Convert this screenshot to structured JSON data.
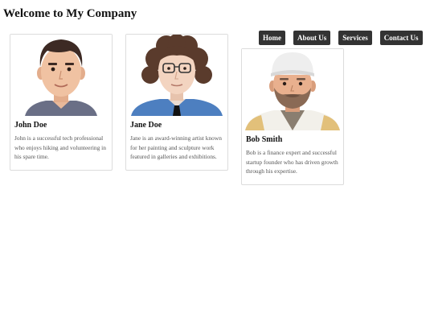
{
  "header": {
    "title": "Welcome to My Company"
  },
  "nav": {
    "items": [
      {
        "label": "Home"
      },
      {
        "label": "About Us"
      },
      {
        "label": "Services"
      },
      {
        "label": "Contact Us"
      }
    ]
  },
  "people": [
    {
      "name": "John Doe",
      "description": "John is a successful tech professional who enjoys hiking and volunteering in his spare time."
    },
    {
      "name": "Jane Doe",
      "description": "Jane is an award-winning artist known for her painting and sculpture work featured in galleries and exhibitions."
    },
    {
      "name": "Bob Smith",
      "description": "Bob is a finance expert and successful startup founder who has driven growth through his expertise."
    }
  ],
  "colors": {
    "nav_bg": "#333333",
    "nav_text": "#ffffff",
    "card_border": "#dcdcdc"
  }
}
